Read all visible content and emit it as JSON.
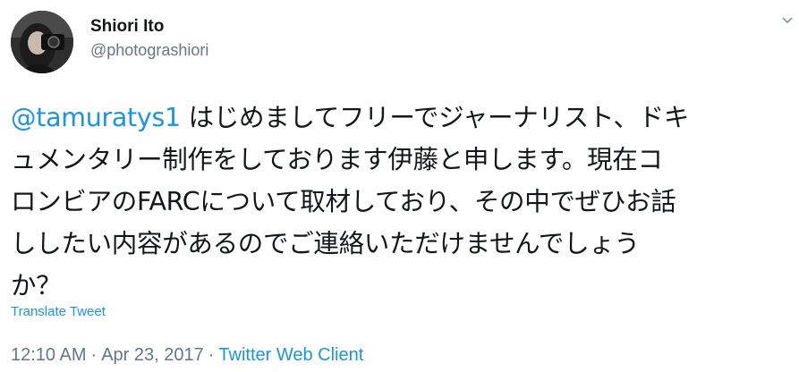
{
  "author": {
    "display_name": "Shiori Ito",
    "handle": "@photograshiori"
  },
  "tweet": {
    "mention": "@tamuratys1",
    "text_lines": [
      " はじめましてフリーでジャーナリスト、ドキ",
      "ュメンタリー制作をしております伊藤と申します。現在コ",
      "ロンビアのFARCについて取材しており、その中でぜひお話",
      "ししたい内容があるのでご連絡いただけませんでしょう",
      "か？"
    ]
  },
  "translate_label": "Translate Tweet",
  "meta": {
    "time": "12:10 AM",
    "separator": "·",
    "date": "Apr 23, 2017",
    "client": "Twitter Web Client"
  },
  "icons": {
    "menu": "chevron-down-icon",
    "avatar": "avatar"
  }
}
